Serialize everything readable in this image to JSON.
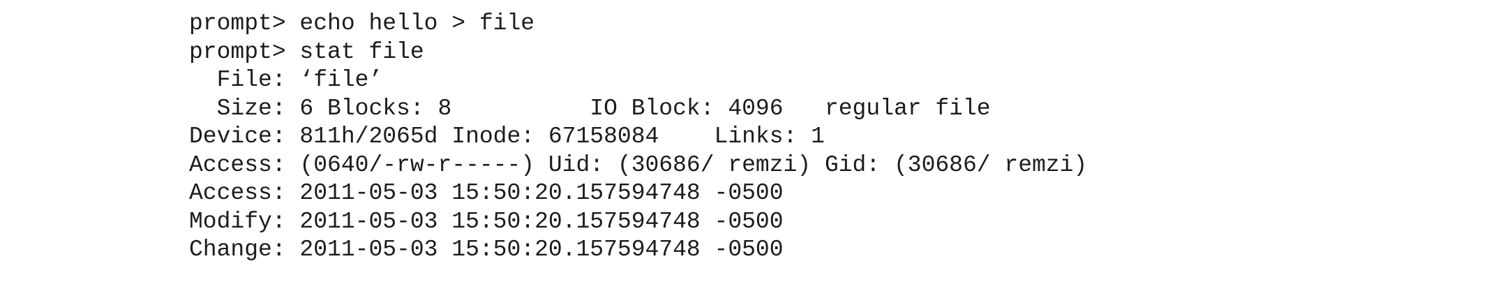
{
  "terminal": {
    "lines": [
      "prompt> echo hello > file",
      "prompt> stat file",
      "  File: ‘file’",
      "  Size: 6 Blocks: 8          IO Block: 4096   regular file",
      "Device: 811h/2065d Inode: 67158084    Links: 1",
      "Access: (0640/-rw-r-----) Uid: (30686/ remzi) Gid: (30686/ remzi)",
      "Access: 2011-05-03 15:50:20.157594748 -0500",
      "Modify: 2011-05-03 15:50:20.157594748 -0500",
      "Change: 2011-05-03 15:50:20.157594748 -0500"
    ]
  }
}
